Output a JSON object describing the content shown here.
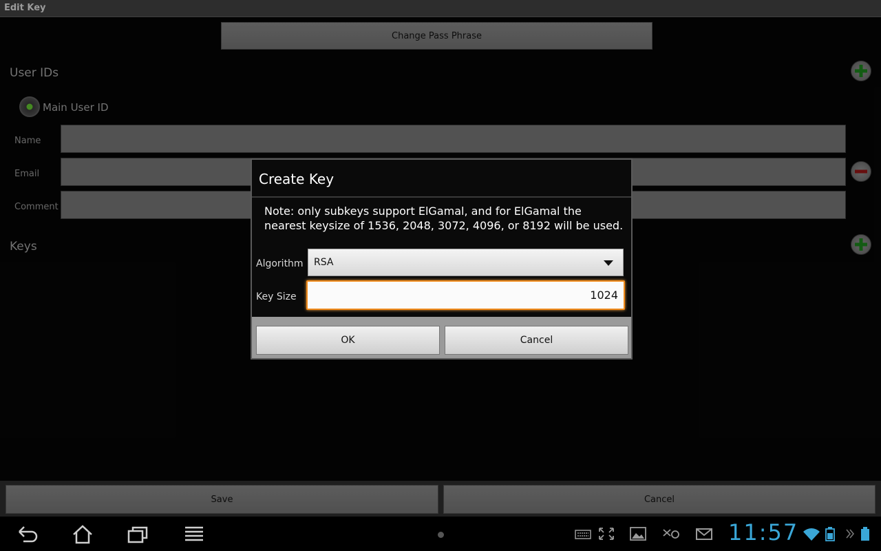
{
  "window": {
    "title": "Edit Key"
  },
  "screen": {
    "change_pass_label": "Change Pass Phrase",
    "user_ids_title": "User IDs",
    "main_user_id_label": "Main User ID",
    "fields": [
      {
        "label": "Name",
        "value": ""
      },
      {
        "label": "Email",
        "value": ""
      },
      {
        "label": "Comment",
        "value": ""
      }
    ],
    "keys_title": "Keys",
    "save_label": "Save",
    "cancel_label": "Cancel"
  },
  "dialog": {
    "title": "Create Key",
    "note": "Note: only subkeys support ElGamal, and for ElGamal the nearest keysize of 1536, 2048, 3072, 4096, or 8192 will be used.",
    "algorithm_label": "Algorithm",
    "algorithm_value": "RSA",
    "key_size_label": "Key Size",
    "key_size_value": "1024",
    "ok_label": "OK",
    "cancel_label": "Cancel"
  },
  "status": {
    "clock": "11:57"
  },
  "colors": {
    "accent_focus": "#f08a1a",
    "clock": "#3aa7d8",
    "add_green": "#1a7a1a",
    "remove_red": "#8a1515",
    "radio_green": "#5cb82e"
  },
  "icons": {
    "nav": [
      "back-icon",
      "home-icon",
      "recent-apps-icon",
      "menu-icon"
    ],
    "status": [
      "keyboard-icon",
      "screen-compat-icon",
      "gallery-icon",
      "email-notification-icon",
      "gmail-icon",
      "wifi-icon",
      "battery-icon"
    ]
  }
}
